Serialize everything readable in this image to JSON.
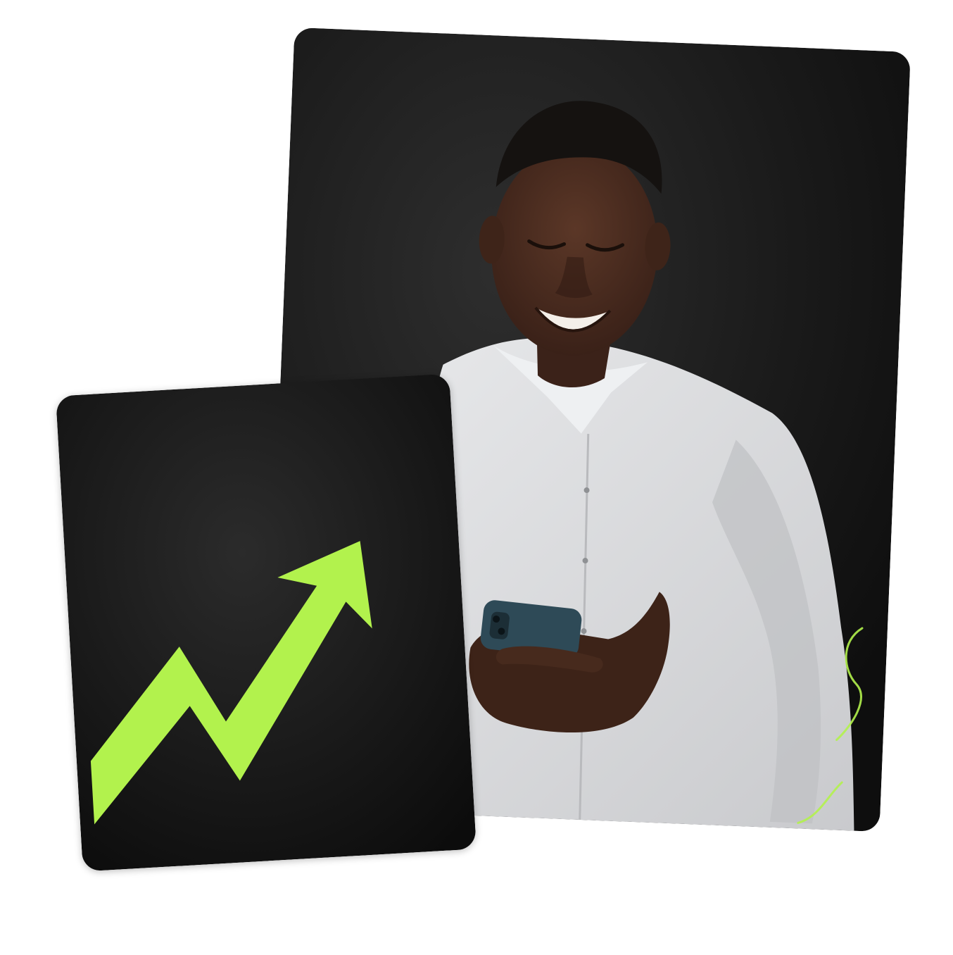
{
  "colors": {
    "background": "#ffffff",
    "card_dark": "#141414",
    "accent_green": "#b2f24d",
    "shirt_gray": "#d9dadc",
    "skin": "#4a2c1f",
    "phone": "#2e4a57"
  },
  "cards": {
    "photo_card": {
      "subject": "man-smiling-at-phone-photo"
    },
    "growth_card": {
      "icon": "trend-up-arrow-icon"
    }
  }
}
